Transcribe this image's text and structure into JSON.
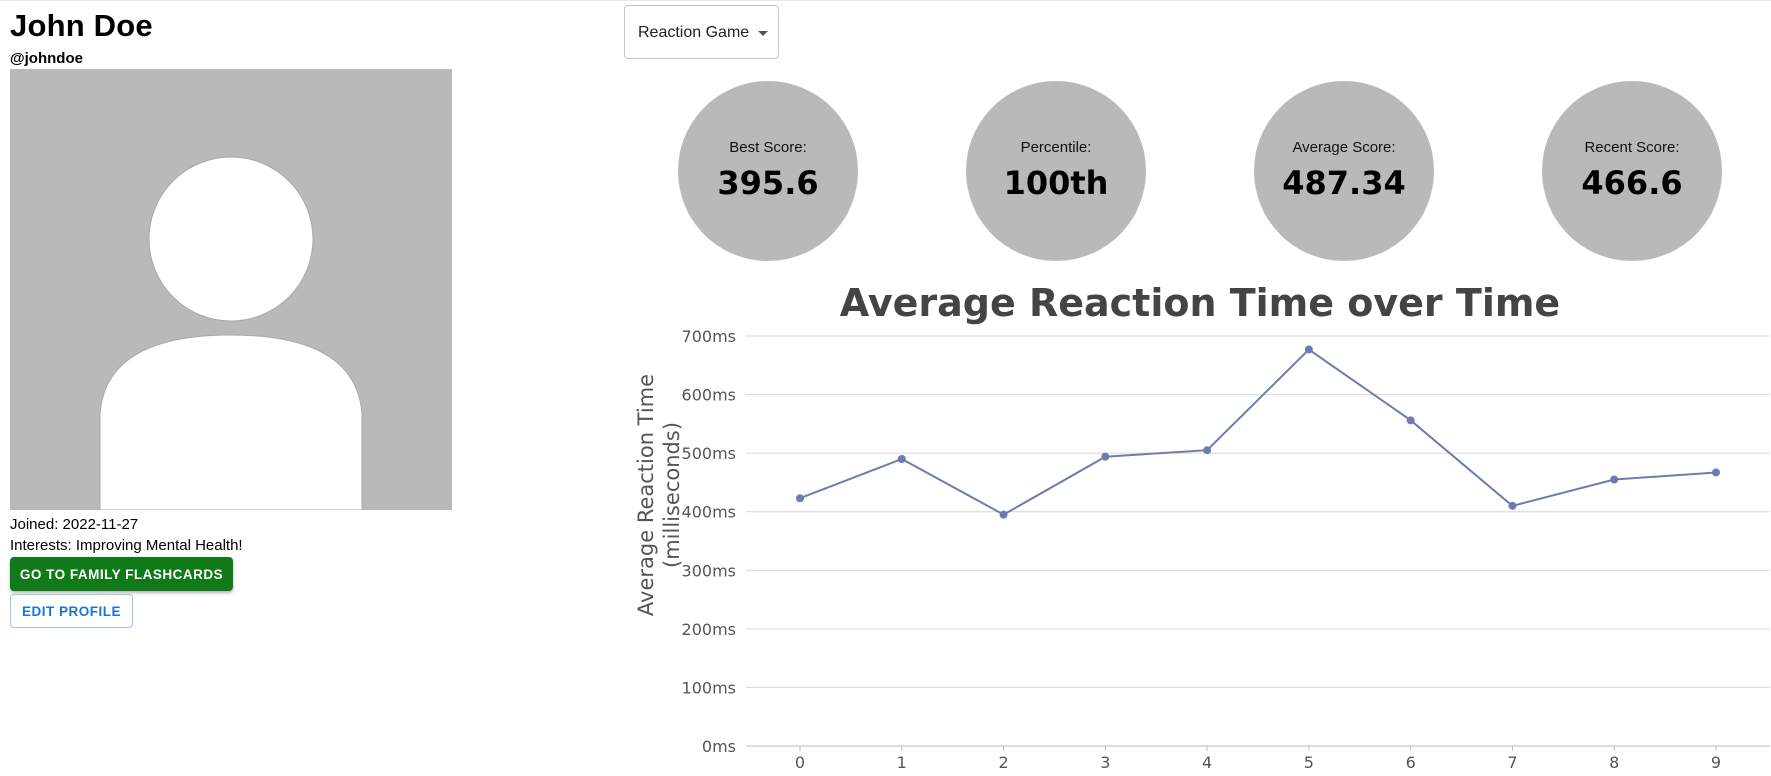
{
  "profile": {
    "name": "John Doe",
    "handle": "@johndoe",
    "joined": "Joined: 2022-11-27",
    "interests": "Interests: Improving Mental Health!",
    "family_button": "GO TO FAMILY FLASHCARDS",
    "edit_button": "EDIT PROFILE"
  },
  "game_select": {
    "value": "Reaction Game",
    "icon": "caret-down-icon"
  },
  "stats": [
    {
      "label": "Best Score:",
      "value": "395.6"
    },
    {
      "label": "Percentile:",
      "value": "100th"
    },
    {
      "label": "Average Score:",
      "value": "487.34"
    },
    {
      "label": "Recent Score:",
      "value": "466.6"
    }
  ],
  "colors": {
    "primary_green": "#0f7a17",
    "link_blue": "#1976d2",
    "circle_gray": "#b9b9b9",
    "series_line": "#6d7bb0"
  },
  "chart_data": {
    "type": "line",
    "title": "Average Reaction Time over Time",
    "ylabel_lines": [
      "Average Reaction Time",
      "(milliseconds)"
    ],
    "x": [
      0,
      1,
      2,
      3,
      4,
      5,
      6,
      7,
      8,
      9
    ],
    "y": [
      423,
      490,
      395,
      494,
      505,
      677,
      556,
      410,
      455,
      467
    ],
    "yticks": [
      "0ms",
      "100ms",
      "200ms",
      "300ms",
      "400ms",
      "500ms",
      "600ms",
      "700ms"
    ],
    "ylim": [
      0,
      700
    ],
    "grid": true
  }
}
